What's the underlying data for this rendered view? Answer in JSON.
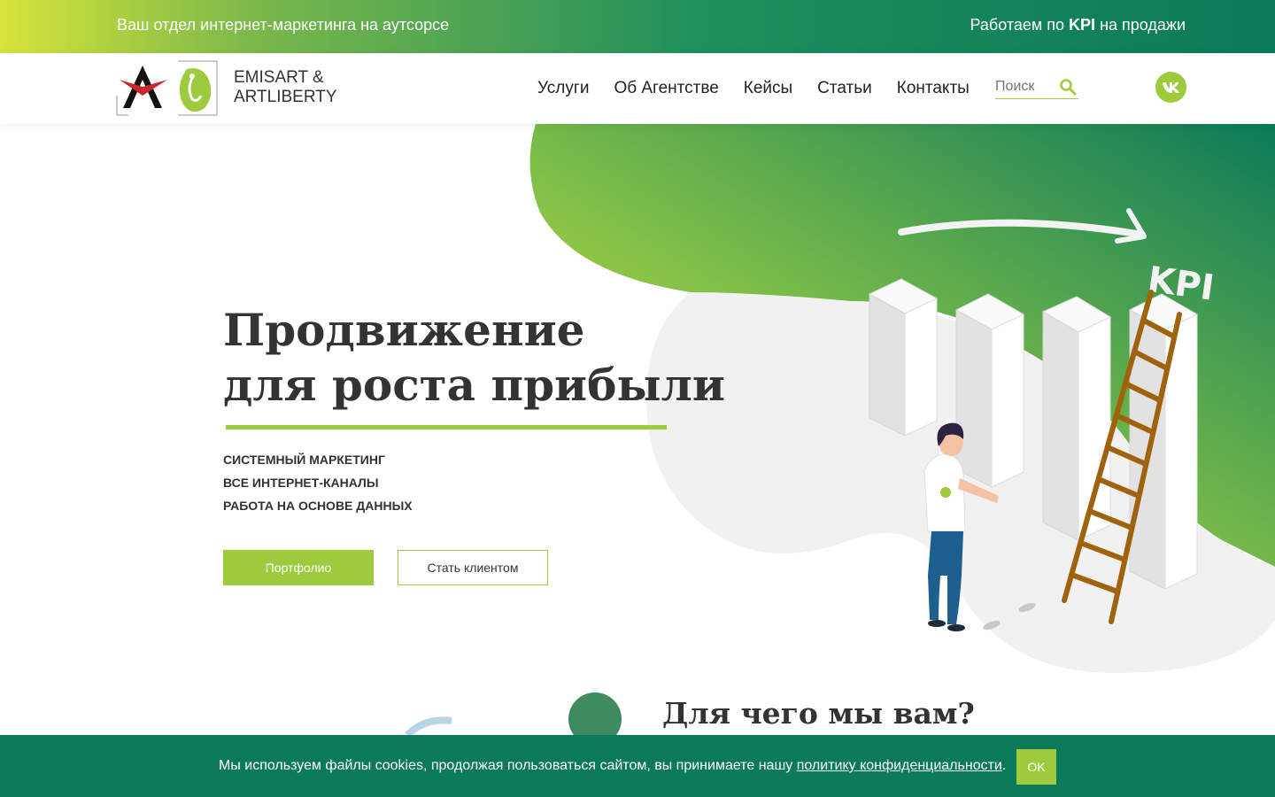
{
  "topbar": {
    "left_text": "Ваш отдел интернет-маркетинга на аутсорсе",
    "right_prefix": "Работаем по ",
    "right_bold": "KPI",
    "right_suffix": " на продажи"
  },
  "header": {
    "brand_line1": "EMISART &",
    "brand_line2": "ARTLIBERTY",
    "nav": [
      "Услуги",
      "Об Агентстве",
      "Кейсы",
      "Статьи",
      "Контакты"
    ],
    "search_placeholder": "Поиск",
    "social_icon": "vk-icon"
  },
  "hero": {
    "title_line1": "Продвижение",
    "title_line2": "для роста прибыли",
    "points": [
      "Системный маркетинг",
      "Все интернет-каналы",
      "Работа на основе данных"
    ],
    "btn_primary": "Портфолио",
    "btn_secondary": "Стать клиентом",
    "illustration_label": "KPI"
  },
  "section2": {
    "title": "Для чего мы вам?"
  },
  "cookie": {
    "text_before": "Мы используем файлы cookies, продолжая пользоваться сайтом, вы принимаете нашу ",
    "link": "политику конфиденциальности",
    "text_after": ".",
    "ok_label": "OK"
  },
  "colors": {
    "accent_green": "#9ecb3d",
    "dark_green": "#0b7a58",
    "yellow": "#d6e43a"
  }
}
